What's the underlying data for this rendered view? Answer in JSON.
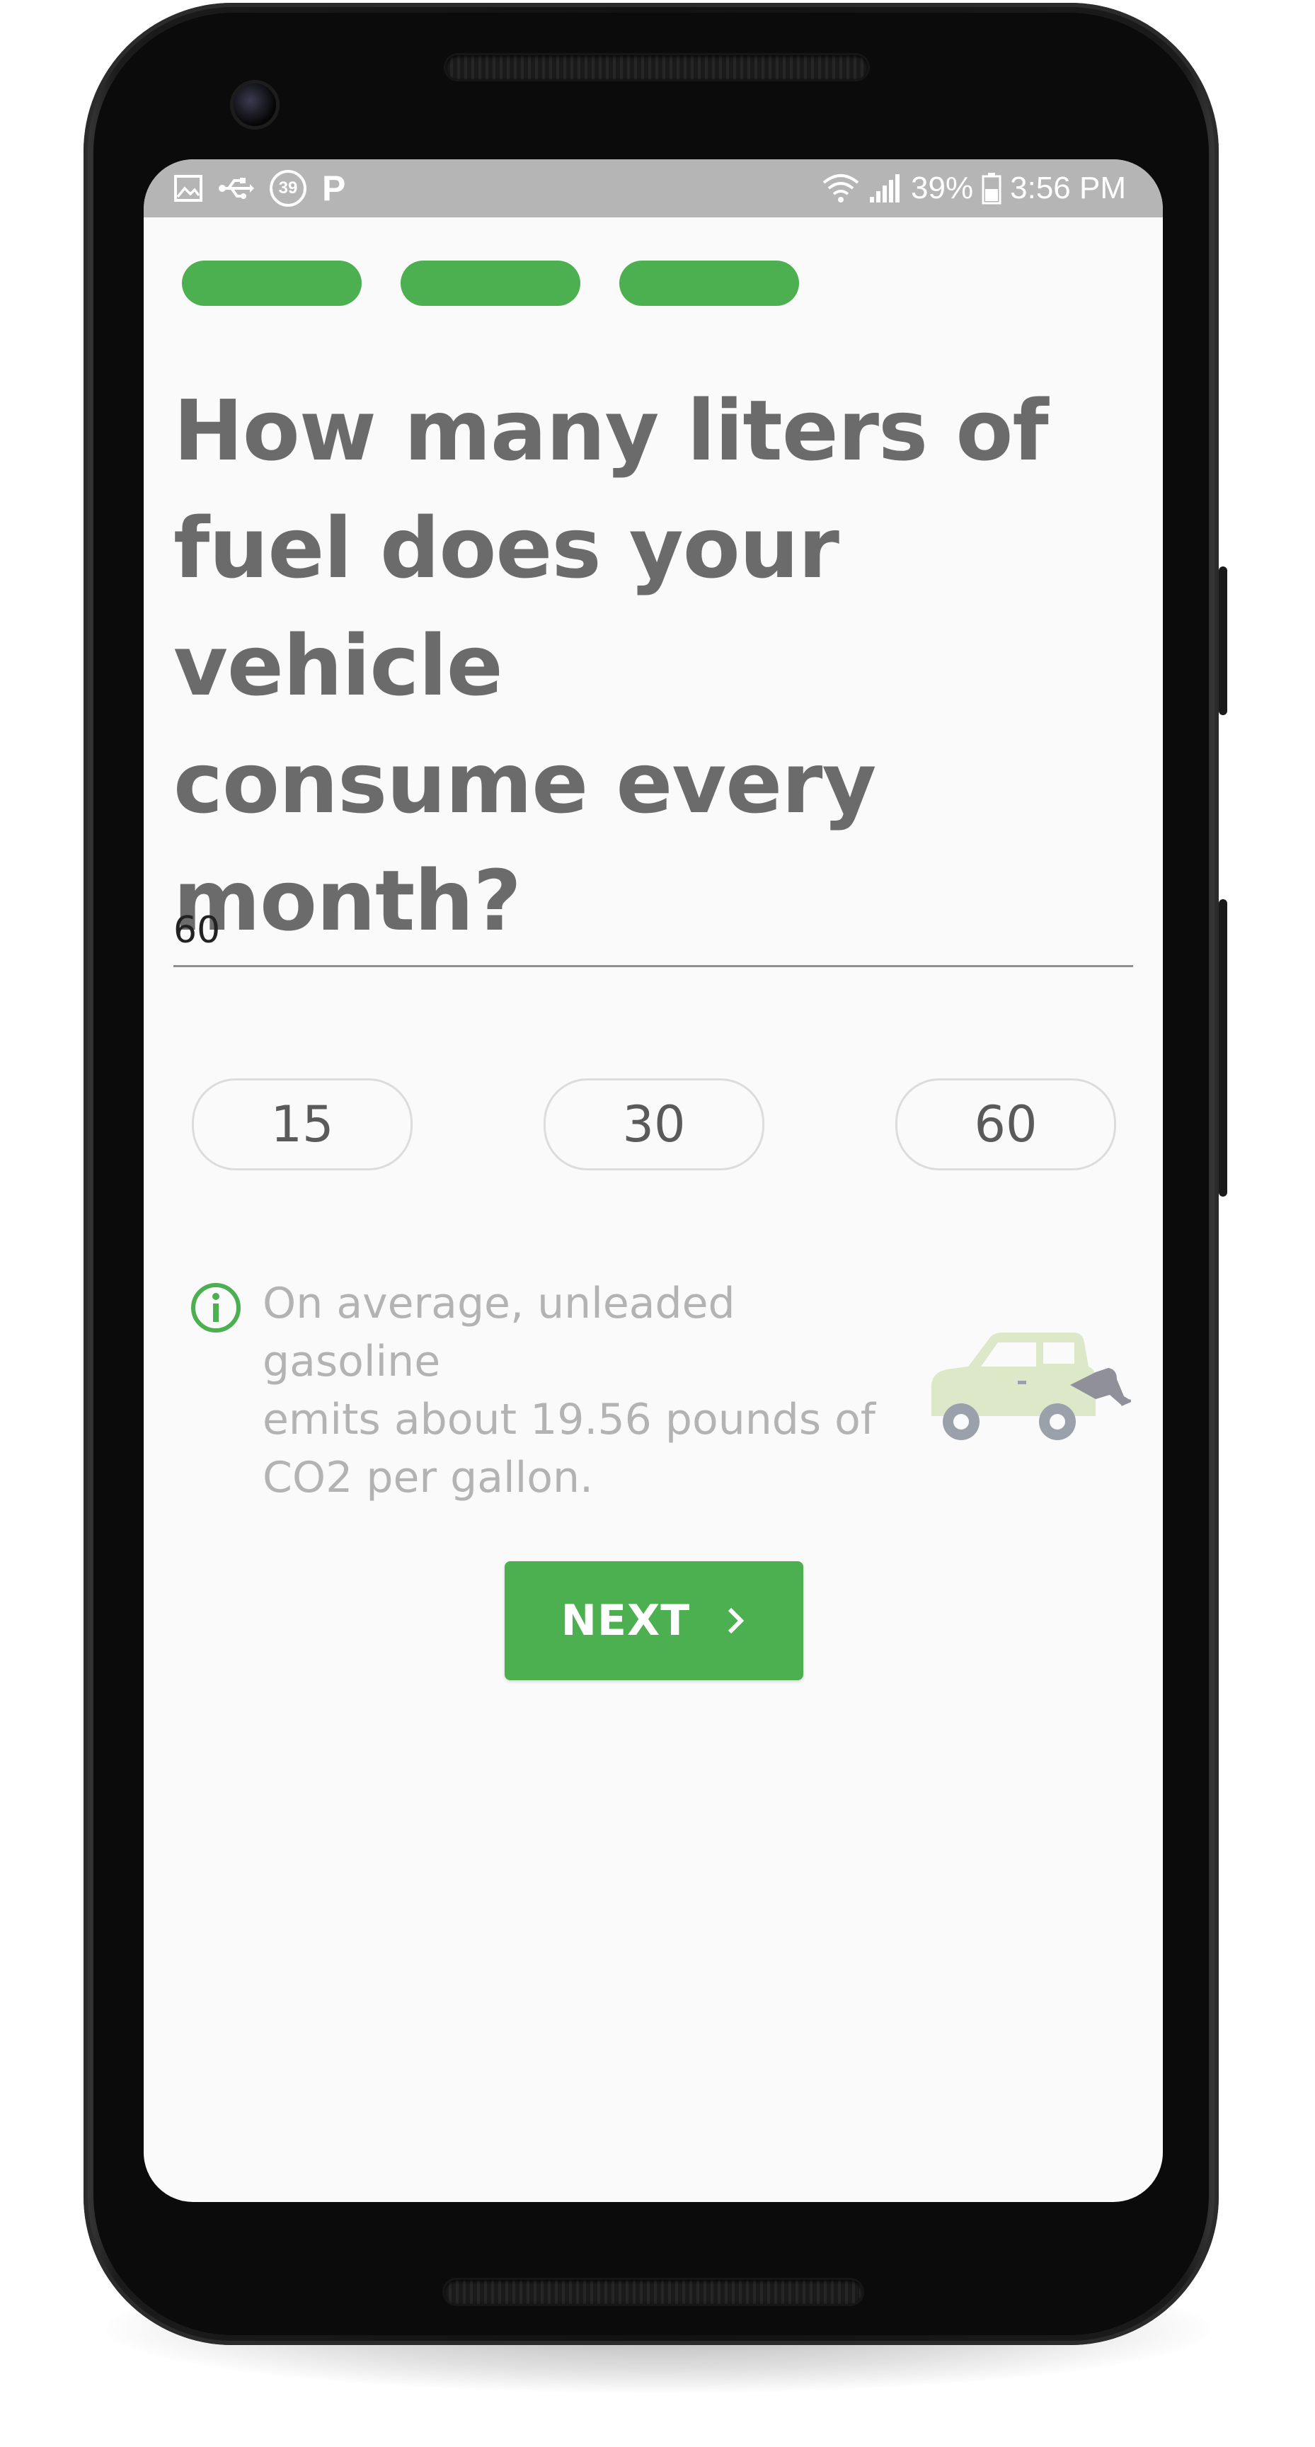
{
  "status_bar": {
    "left_icons": [
      "gallery-icon",
      "usb-icon",
      "badge-39-icon",
      "parking-icon"
    ],
    "badge_text": "39",
    "parking_text": "P",
    "battery_percent": "39%",
    "time": "3:56 PM",
    "right_icons": [
      "wifi-icon",
      "signal-icon",
      "battery-icon"
    ]
  },
  "progress": {
    "steps_total": 3,
    "steps_completed": 3,
    "color": "#4caf50"
  },
  "question": {
    "line1": "How many liters of",
    "line2": "fuel does your vehicle",
    "line3": "consume every",
    "line4": "month?"
  },
  "input": {
    "value": "60"
  },
  "quick_options": [
    "15",
    "30",
    "60"
  ],
  "tip": {
    "icon": "info-icon",
    "line1": "On average, unleaded gasoline",
    "line2": "emits about 19.56 pounds of",
    "line3": "CO2 per gallon.",
    "illustration": "car-refuel-icon"
  },
  "next_button": {
    "label": "NEXT",
    "icon": "chevron-right-icon",
    "color": "#4caf50"
  },
  "colors": {
    "accent": "#4caf50",
    "question_text": "#6b6b6b",
    "tip_text": "#b3b3b3",
    "status_bar": "#b5b5b5"
  }
}
